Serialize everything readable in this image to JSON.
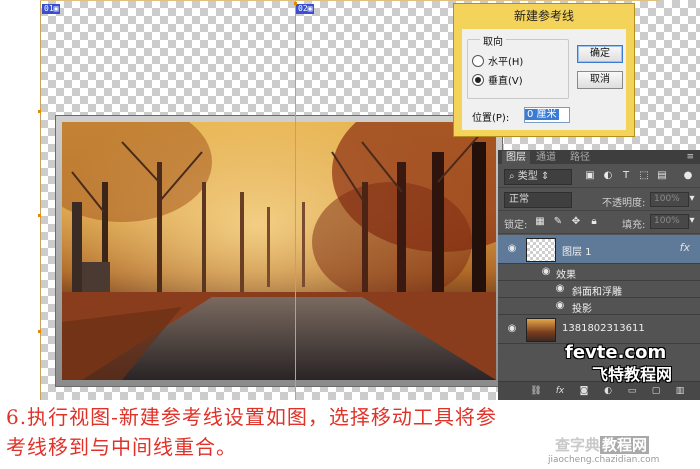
{
  "slices": {
    "tag1": "01",
    "tag2": "02"
  },
  "dialog": {
    "title": "新建参考线",
    "group_label": "取向",
    "option_horizontal": "水平(H)",
    "option_vertical": "垂直(V)",
    "selected": "vertical",
    "position_label": "位置(P):",
    "position_value": "0 厘米",
    "ok_label": "确定",
    "cancel_label": "取消"
  },
  "layers_panel": {
    "tabs": [
      "图层",
      "通道",
      "路径"
    ],
    "active_tab": "图层",
    "menu_icon": "≡",
    "filter_label": "类型",
    "blend_mode": "正常",
    "opacity_label": "不透明度:",
    "opacity_value": "100%",
    "lock_label": "锁定:",
    "fill_label": "填充:",
    "fill_value": "100%",
    "layers": [
      {
        "name": "图层 1",
        "fx": "fx",
        "selected": true
      },
      {
        "name": "1381802313611",
        "selected": false
      }
    ],
    "effects_label": "效果",
    "effects": [
      "斜面和浮雕",
      "投影"
    ],
    "bottom_icons": [
      "link-icon",
      "fx-icon",
      "mask-icon",
      "adjustment-icon",
      "folder-icon",
      "new-layer-icon",
      "trash-icon"
    ]
  },
  "watermarks": {
    "site1": "fevte.com",
    "site1_cn": "飞特教程网",
    "site2_a": "查字典",
    "site2_b": "教程网",
    "site2_url": "jiaocheng.chazidian.com"
  },
  "caption": {
    "line1": "6.执行视图-新建参考线设置如图，选择移动工具将参",
    "line2": "考线移到与中间线重合。"
  },
  "colors": {
    "caption": "#e03228",
    "dialog": "#f4d35a",
    "panel": "#535353",
    "selected_layer": "#5f7a99"
  }
}
